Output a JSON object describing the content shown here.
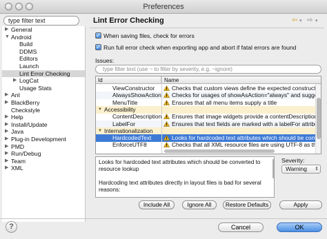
{
  "window": {
    "title": "Preferences"
  },
  "sidebar": {
    "filter_value": "type filter text",
    "items": [
      {
        "label": "General",
        "twisty": "▶"
      },
      {
        "label": "Android",
        "twisty": "▼"
      },
      {
        "label": "Build",
        "twisty": ""
      },
      {
        "label": "DDMS",
        "twisty": ""
      },
      {
        "label": "Editors",
        "twisty": ""
      },
      {
        "label": "Launch",
        "twisty": ""
      },
      {
        "label": "Lint Error Checking",
        "twisty": ""
      },
      {
        "label": "LogCat",
        "twisty": "▶"
      },
      {
        "label": "Usage Stats",
        "twisty": ""
      },
      {
        "label": "Ant",
        "twisty": "▶"
      },
      {
        "label": "BlackBerry",
        "twisty": "▶"
      },
      {
        "label": "Checkstyle",
        "twisty": ""
      },
      {
        "label": "Help",
        "twisty": "▶"
      },
      {
        "label": "Install/Update",
        "twisty": "▶"
      },
      {
        "label": "Java",
        "twisty": "▶"
      },
      {
        "label": "Plug-in Development",
        "twisty": "▶"
      },
      {
        "label": "PMD",
        "twisty": "▶"
      },
      {
        "label": "Run/Debug",
        "twisty": "▶"
      },
      {
        "label": "Team",
        "twisty": "▶"
      },
      {
        "label": "XML",
        "twisty": "▶"
      }
    ]
  },
  "page": {
    "title": "Lint Error Checking",
    "nav_back": "⇦",
    "nav_fwd": "⇨",
    "check1_label": "When saving files, check for errors",
    "check2_label": "Run full error check when exporting app and abort if fatal errors are found",
    "issues_label": "Issues:",
    "issues_filter_placeholder": "type filter text (use ~ to filter by severity, e.g. ~ignore)",
    "table": {
      "col_id": "Id",
      "col_name": "Name",
      "rows": [
        {
          "id": "ViewConstructor",
          "name": "Checks that custom views define the expected constructor",
          "kind": "item"
        },
        {
          "id": "AlwaysShowAction",
          "name": "Checks for usages of showAsAction=\"always\" and suggests s",
          "kind": "item"
        },
        {
          "id": "MenuTitle",
          "name": "Ensures that all menu items supply a title",
          "kind": "item"
        },
        {
          "id": "Accessibility",
          "name": "",
          "kind": "category"
        },
        {
          "id": "ContentDescription",
          "name": "Ensures that image widgets provide a contentDescription",
          "kind": "item"
        },
        {
          "id": "LabelFor",
          "name": "Ensures that text fields are marked with a labelFor attribut",
          "kind": "item"
        },
        {
          "id": "Internationalization",
          "name": "",
          "kind": "category"
        },
        {
          "id": "HardcodedText",
          "name": "Looks for hardcoded text attributes which should be conve",
          "kind": "selected"
        },
        {
          "id": "EnforceUTF8",
          "name": "Checks that all XML resource files are using UTF-8 as the f",
          "kind": "item"
        }
      ]
    },
    "description": {
      "para1": "Looks for hardcoded text attributes which should be converted to resource lookup",
      "para2": "Hardcoding text attributes directly in layout files is bad for several reasons:"
    },
    "severity": {
      "label": "Severity:",
      "value": "Warning"
    },
    "buttons": {
      "include_all": "Include All",
      "ignore_all": "Ignore All",
      "restore": "Restore Defaults",
      "apply": "Apply"
    }
  },
  "footer": {
    "help": "?",
    "cancel": "Cancel",
    "ok": "OK"
  },
  "colors": {
    "accent": "#3d7ad6",
    "category": "#fbf0ce",
    "warning": "#e8b321"
  }
}
